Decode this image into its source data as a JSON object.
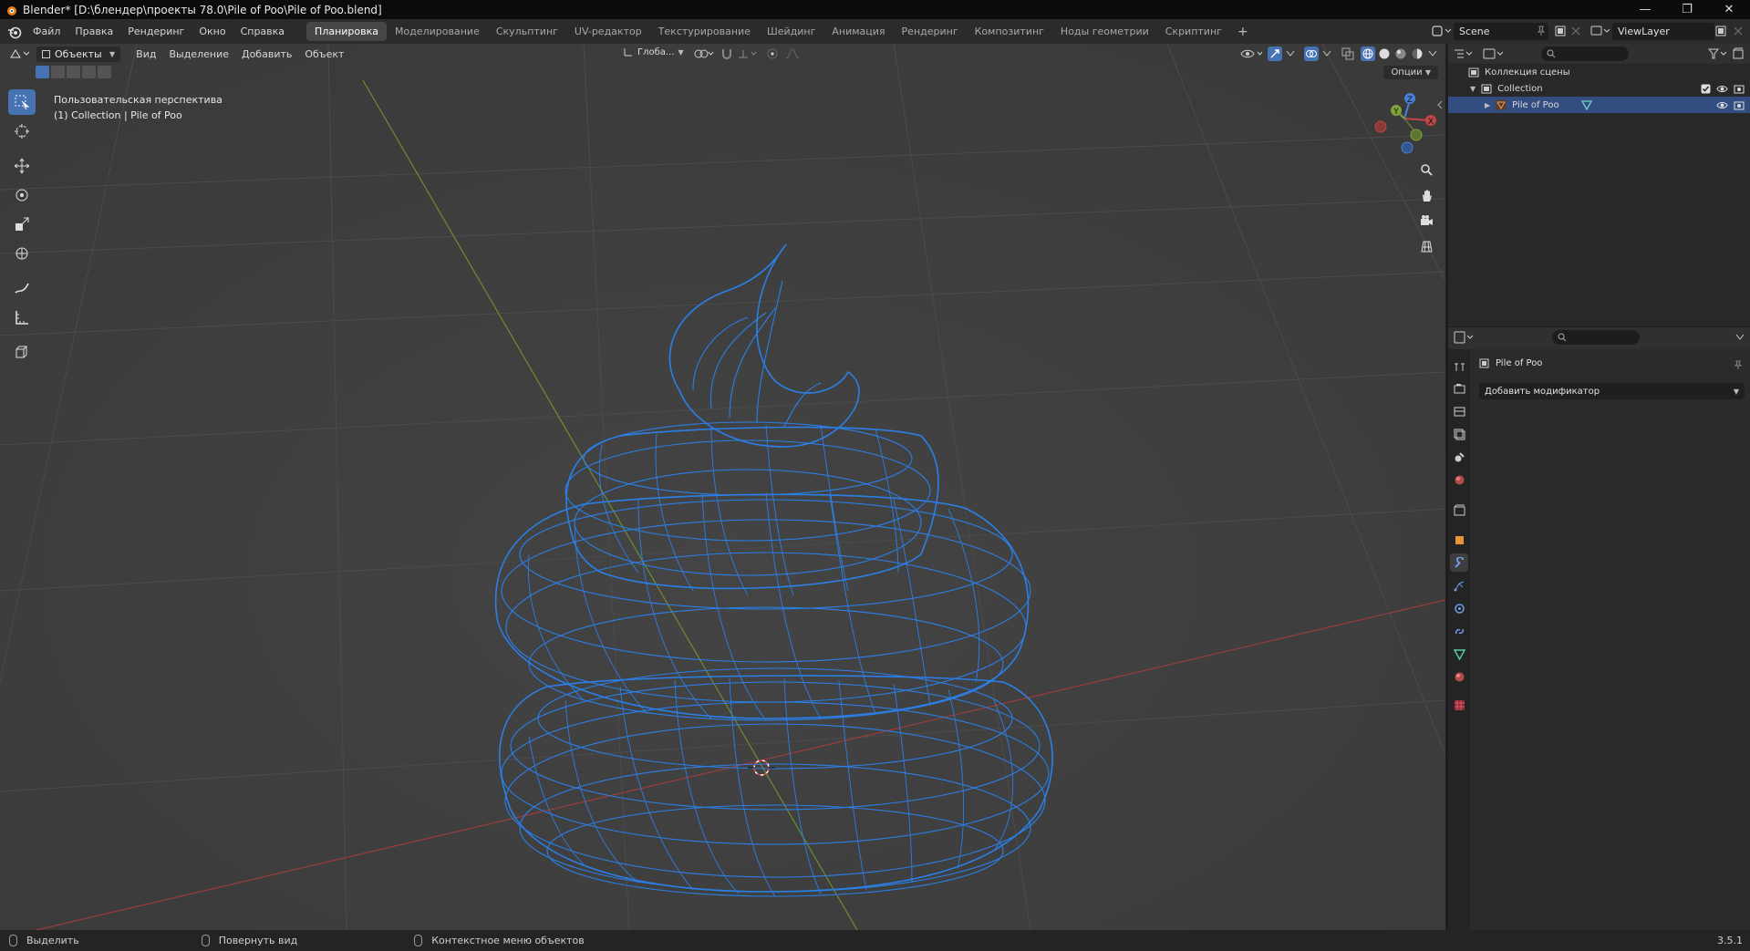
{
  "window": {
    "title": "Blender* [D:\\блендер\\проекты 78.0\\Pile of Poo\\Pile of Poo.blend]",
    "controls": [
      "—",
      "❐",
      "✕"
    ]
  },
  "menu": [
    "Файл",
    "Правка",
    "Рендеринг",
    "Окно",
    "Справка"
  ],
  "workspaces": [
    {
      "label": "Планировка",
      "active": true
    },
    {
      "label": "Моделирование"
    },
    {
      "label": "Скульптинг"
    },
    {
      "label": "UV-редактор"
    },
    {
      "label": "Текстурирование"
    },
    {
      "label": "Шейдинг"
    },
    {
      "label": "Анимация"
    },
    {
      "label": "Рендеринг"
    },
    {
      "label": "Композитинг"
    },
    {
      "label": "Ноды геометрии"
    },
    {
      "label": "Скриптинг"
    }
  ],
  "workspace_add": "+",
  "scene_name": "Scene",
  "view_layer": "ViewLayer",
  "viewport": {
    "mode": "Объекты",
    "menu": [
      "Вид",
      "Выделение",
      "Добавить",
      "Объект"
    ],
    "transform_orientation": "Глоба...",
    "options_label": "Опции",
    "view_name": "Пользовательская перспектива",
    "collection_info": "(1) Collection | Pile of Poo",
    "gizmo_axes": {
      "x": "X",
      "y": "Y",
      "z": "Z"
    }
  },
  "tools": [
    "select-box",
    "cursor",
    "move",
    "rotate",
    "scale",
    "transform",
    "annotate",
    "measure",
    "add-cube"
  ],
  "status": {
    "select": "Выделить",
    "rotate": "Повернуть вид",
    "context": "Контекстное меню объектов",
    "version": "3.5.1"
  },
  "outliner": {
    "root": "Коллекция сцены",
    "collection": "Collection",
    "object": "Pile of Poo"
  },
  "properties": {
    "object_name": "Pile of Poo",
    "add_modifier": "Добавить модификатор"
  },
  "colors": {
    "accent": "#4772b3",
    "wire": "#1f7ae8",
    "x_axis": "#c04545",
    "y_axis": "#7ea33a",
    "z_axis": "#4a7fd8"
  }
}
